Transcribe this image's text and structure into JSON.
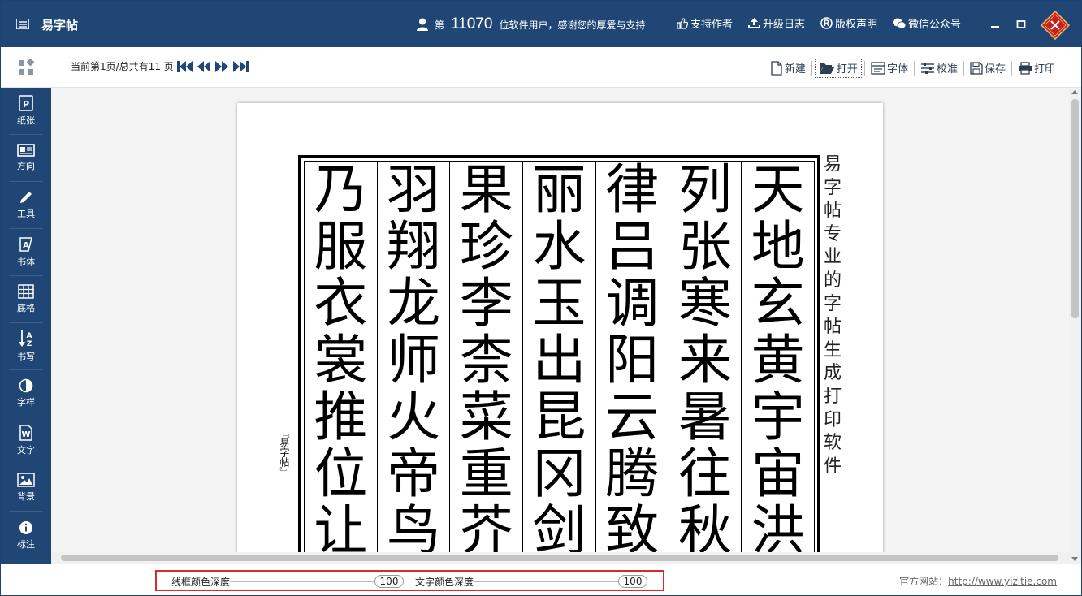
{
  "app": {
    "title": "易字帖"
  },
  "header": {
    "user_prefix": "第",
    "user_count": "11070",
    "user_suffix": "位软件用户，感谢您的厚爱与支持",
    "links": [
      {
        "label": "支持作者",
        "icon": "thumbs-up-icon"
      },
      {
        "label": "升级日志",
        "icon": "upload-icon"
      },
      {
        "label": "版权声明",
        "icon": "registered-icon"
      },
      {
        "label": "微信公众号",
        "icon": "wechat-icon"
      }
    ]
  },
  "pager": {
    "info": "当前第1页/总共有11 页"
  },
  "toolbar": {
    "new_label": "新建",
    "open_label": "打开",
    "font_label": "字体",
    "calibrate_label": "校准",
    "save_label": "保存",
    "print_label": "打印"
  },
  "sidebar": {
    "items": [
      {
        "label": "纸张",
        "icon": "paper-icon"
      },
      {
        "label": "方向",
        "icon": "orientation-icon"
      },
      {
        "label": "工具",
        "icon": "pencil-icon"
      },
      {
        "label": "书体",
        "icon": "calligraphy-icon"
      },
      {
        "label": "底格",
        "icon": "grid-icon"
      },
      {
        "label": "书写",
        "icon": "sort-az-icon"
      },
      {
        "label": "字样",
        "icon": "contrast-icon"
      },
      {
        "label": "文字",
        "icon": "word-icon"
      },
      {
        "label": "背景",
        "icon": "image-icon"
      },
      {
        "label": "标注",
        "icon": "info-icon"
      }
    ]
  },
  "paper": {
    "columns": [
      [
        "天",
        "地",
        "玄",
        "黄",
        "宇",
        "宙",
        "洪"
      ],
      [
        "列",
        "张",
        "寒",
        "来",
        "暑",
        "往",
        "秋"
      ],
      [
        "律",
        "吕",
        "调",
        "阳",
        "云",
        "腾",
        "致"
      ],
      [
        "丽",
        "水",
        "玉",
        "出",
        "昆",
        "冈",
        "剑"
      ],
      [
        "果",
        "珍",
        "李",
        "柰",
        "菜",
        "重",
        "芥"
      ],
      [
        "羽",
        "翔",
        "龙",
        "师",
        "火",
        "帝",
        "鸟"
      ],
      [
        "乃",
        "服",
        "衣",
        "裳",
        "推",
        "位",
        "让"
      ]
    ],
    "side_text": "易字帖专业的字帖生成打印软件",
    "brand_mark": "『易字帖』"
  },
  "status": {
    "frame_color_label": "线框颜色深度",
    "frame_color_value": "100",
    "text_color_label": "文字颜色深度",
    "text_color_value": "100",
    "website_prefix": "官方网站：",
    "website_url": "http://www.yizitie.com"
  },
  "colors": {
    "primary": "#1f4674",
    "highlight_border": "#d62b2b"
  }
}
